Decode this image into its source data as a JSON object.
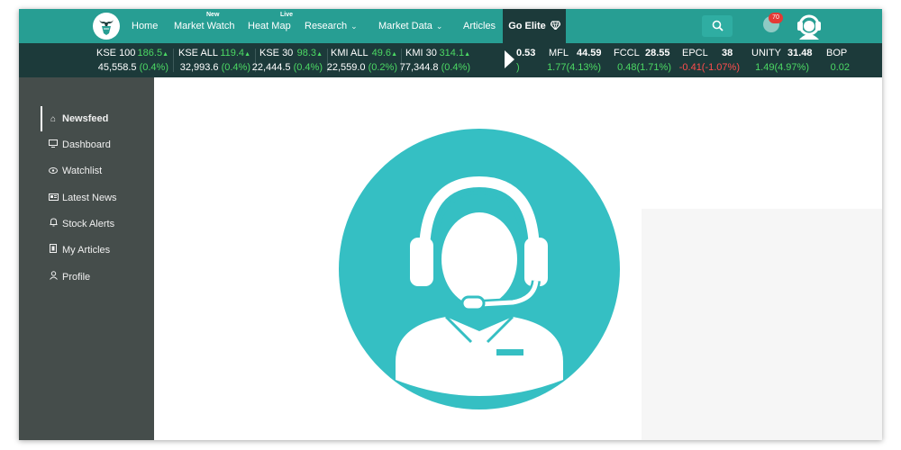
{
  "nav": {
    "items": [
      {
        "label": "Home"
      },
      {
        "label": "Market Watch",
        "badge": "New"
      },
      {
        "label": "Heat Map",
        "badge": "Live"
      },
      {
        "label": "Research",
        "dropdown": true
      },
      {
        "label": "Market Data",
        "dropdown": true
      },
      {
        "label": "Articles"
      }
    ],
    "go_elite": "Go Elite",
    "notification_count": "70"
  },
  "ticker": {
    "indices": [
      {
        "name": "KSE 100",
        "change": "186.5",
        "value": "45,558.5",
        "pct": "(0.4%)"
      },
      {
        "name": "KSE ALL",
        "change": "119.4",
        "value": "32,993.6",
        "pct": "(0.4%)"
      },
      {
        "name": "KSE 30",
        "change": "98.3",
        "value": "22,444.5",
        "pct": "(0.4%)"
      },
      {
        "name": "KMI ALL",
        "change": "49.6",
        "value": "22,559.0",
        "pct": "(0.2%)"
      },
      {
        "name": "KMI 30",
        "change": "314.1",
        "value": "77,344.8",
        "pct": "(0.4%)"
      }
    ],
    "stocks": [
      {
        "symbol": "",
        "price": "0.53",
        "change": ")",
        "direction": "up"
      },
      {
        "symbol": "MFL",
        "price": "44.59",
        "change": "1.77(4.13%)",
        "direction": "up"
      },
      {
        "symbol": "FCCL",
        "price": "28.55",
        "change": "0.48(1.71%)",
        "direction": "up"
      },
      {
        "symbol": "EPCL",
        "price": "38",
        "change": "-0.41(-1.07%)",
        "direction": "down"
      },
      {
        "symbol": "UNITY",
        "price": "31.48",
        "change": "1.49(4.97%)",
        "direction": "up"
      },
      {
        "symbol": "BOP",
        "price": "",
        "change": "0.02",
        "direction": "up"
      }
    ]
  },
  "sidebar": {
    "items": [
      {
        "label": "Newsfeed",
        "icon": "home-icon",
        "active": true
      },
      {
        "label": "Dashboard",
        "icon": "monitor-icon"
      },
      {
        "label": "Watchlist",
        "icon": "eye-icon"
      },
      {
        "label": "Latest News",
        "icon": "newspaper-icon"
      },
      {
        "label": "Stock Alerts",
        "icon": "bell-icon"
      },
      {
        "label": "My Articles",
        "icon": "document-icon"
      },
      {
        "label": "Profile",
        "icon": "user-icon"
      }
    ]
  },
  "colors": {
    "nav_bg": "#279e93",
    "ticker_bg": "#1c3a3a",
    "sidebar_bg": "#454d4b",
    "accent_teal": "#35bfc3",
    "up": "#4cd964",
    "down": "#ff4d4d"
  }
}
